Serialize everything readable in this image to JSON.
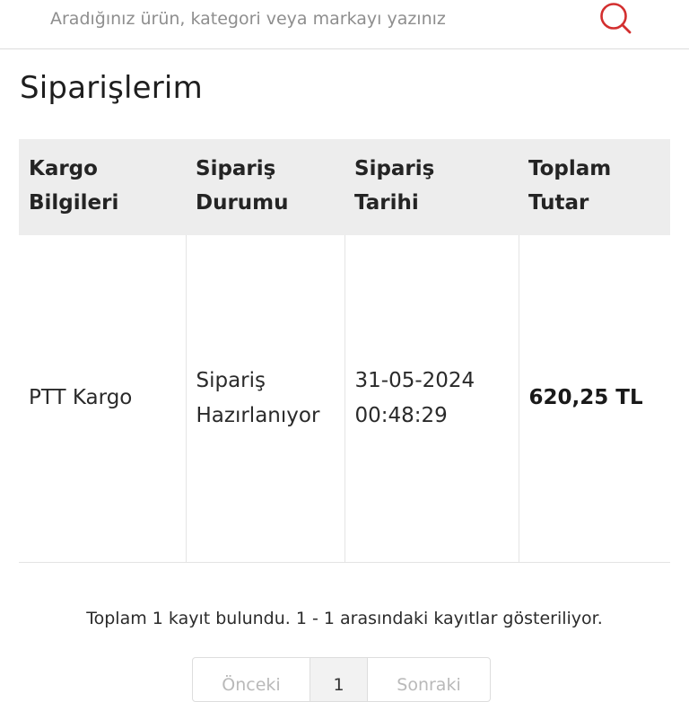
{
  "search": {
    "placeholder": "Aradığınız ürün, kategori veya markayı yazınız",
    "icon": "search-icon",
    "accent_color": "#d32f2f"
  },
  "page": {
    "title": "Siparişlerim"
  },
  "table": {
    "headers": [
      {
        "line1": "Kargo",
        "line2": "Bilgileri"
      },
      {
        "line1": "Sipariş",
        "line2": "Durumu"
      },
      {
        "line1": "Sipariş",
        "line2": "Tarihi"
      },
      {
        "line1": "Toplam",
        "line2": "Tutar"
      }
    ],
    "rows": [
      {
        "cargo": "PTT Kargo",
        "status_line1": "Sipariş",
        "status_line2": "Hazırlanıyor",
        "date": "31-05-2024",
        "time": "00:48:29",
        "total": "620,25 TL"
      }
    ]
  },
  "summary": {
    "text": "Toplam 1 kayıt bulundu. 1 - 1 arasındaki kayıtlar gösteriliyor."
  },
  "pagination": {
    "prev_label": "Önceki",
    "current_page": "1",
    "next_label": "Sonraki"
  }
}
